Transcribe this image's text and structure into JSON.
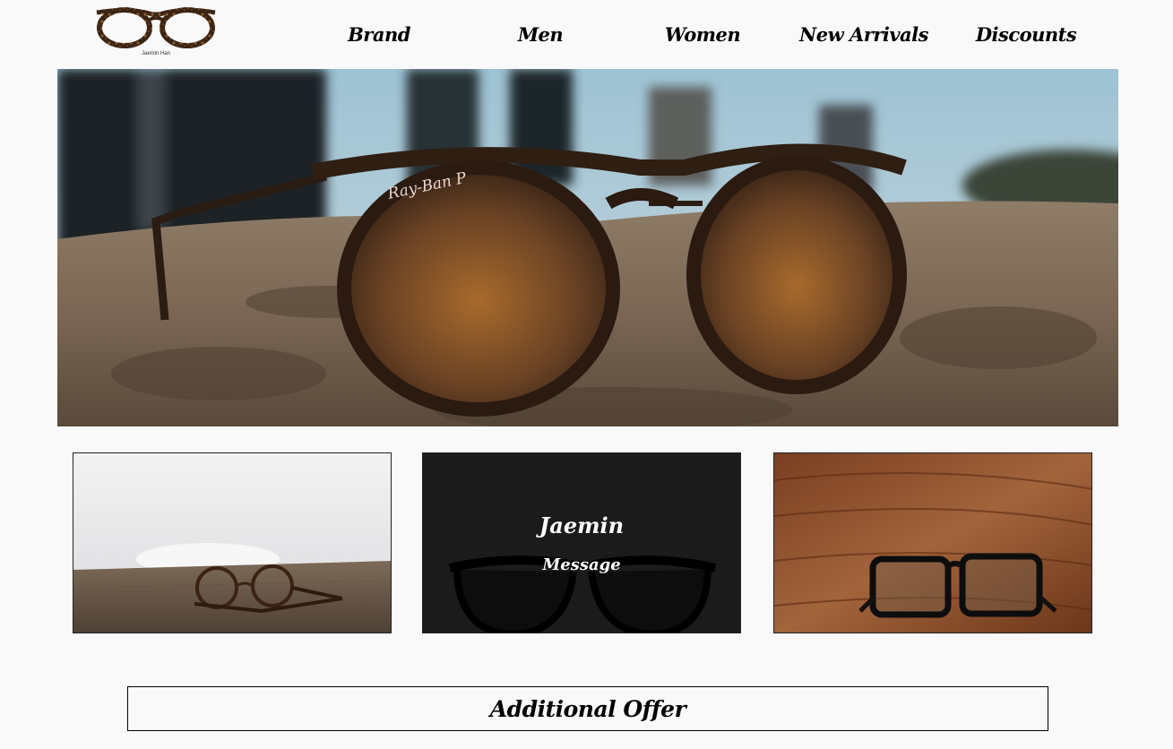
{
  "logo": {
    "icon": "eyeglasses-logo-icon",
    "caption": "Jaemin Han"
  },
  "nav": {
    "items": [
      {
        "label": "Brand"
      },
      {
        "label": "Men"
      },
      {
        "label": "Women"
      },
      {
        "label": "New Arrivals"
      },
      {
        "label": "Discounts"
      }
    ]
  },
  "hero": {
    "image": "sunglasses-on-rock-photo",
    "lens_brand_text": "Ray-Ban P"
  },
  "cards": [
    {
      "image": "round-glasses-on-table-photo"
    },
    {
      "image": "black-glasses-dark-photo",
      "title": "Jaemin",
      "subtitle": "Message"
    },
    {
      "image": "square-glasses-on-wood-photo"
    }
  ],
  "offer": {
    "label": "Additional Offer"
  },
  "colors": {
    "background": "#f9f9f9",
    "text": "#000000",
    "card_overlay_text": "#ffffff"
  }
}
